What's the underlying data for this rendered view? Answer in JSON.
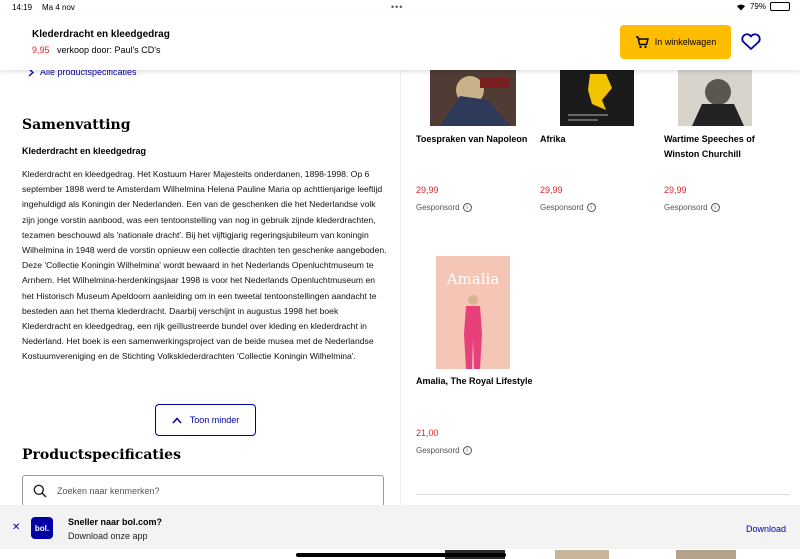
{
  "status": {
    "time": "14:19",
    "date": "Ma 4 nov",
    "battery": "79%"
  },
  "header": {
    "title": "Klederdracht en kleedgedrag",
    "price": "9,95",
    "seller": "verkoop door: Paul's CD's",
    "cart_label": "In winkelwagen"
  },
  "specs_link": "Alle productspecificaties",
  "summary": {
    "heading": "Samenvatting",
    "subtitle": "Klederdracht en kleedgedrag",
    "body": "Klederdracht en kleedgedrag. Het Kostuum Harer Majesteits onderdanen, 1898-1998. Op 6 september 1898 werd te Amsterdam Wilhelmina Helena Pauline Maria op achttienjarige leeftijd ingehuldigd als Koningin der Nederlanden. Een van de geschenken die het Nederlandse volk zijn jonge vorstin aanbood, was een tentoonstelling van nog in gebruik zijnde klederdrachten, tezamen beschouwd als 'nationale dracht'. Bij het vijftigjarig regeringsjubileum van koningin Wilhelmina in 1948 werd de vorstin opnieuw een collectie drachten ten geschenke aangeboden. Deze 'Collectie Koningin Wilhelmina' wordt bewaard in het Nederlands Openluchtmuseum te Arnhem. Het Wilhelmina-herdenkingsjaar 1998 is voor het Nederlands Openluchtmuseum en het Historisch Museum Apeldoorn aanleiding om in een tweetal tentoonstellingen aandacht te besteden aan het thema klederdracht. Daarbij verschijnt in augustus 1998 het boek Klederdracht en kleedgedrag, een rijk geïllustreerde bundel over kleding en klederdracht in Nederland. Het boek is een samenwerkingsproject van de beide musea met de Nederlandse Kostuumvereniging en de Stichting Volksklederdrachten 'Collectie Koningin Wilhelmina'.",
    "toggle_label": "Toon minder"
  },
  "specs": {
    "heading": "Productspecificaties",
    "search_placeholder": "Zoeken naar kenmerken?"
  },
  "products": [
    {
      "name": "Toespraken van Napoleon",
      "price": "29,99",
      "sponsored": "Gesponsord"
    },
    {
      "name": "Afrika",
      "price": "29,99",
      "sponsored": "Gesponsord"
    },
    {
      "name": "Wartime Speeches of Winston Churchill",
      "price": "29,99",
      "sponsored": "Gesponsord"
    },
    {
      "name": "Amalia, The Royal Lifestyle",
      "price": "21,00",
      "sponsored": "Gesponsord",
      "cover_title": "Amalia"
    }
  ],
  "banner": {
    "logo": "bol.",
    "title": "Sneller naar bol.com?",
    "subtitle": "Download onze app",
    "download": "Download"
  },
  "colors": {
    "accent": "#0000a4",
    "price": "#e0262b",
    "cart": "#ffbd00"
  }
}
